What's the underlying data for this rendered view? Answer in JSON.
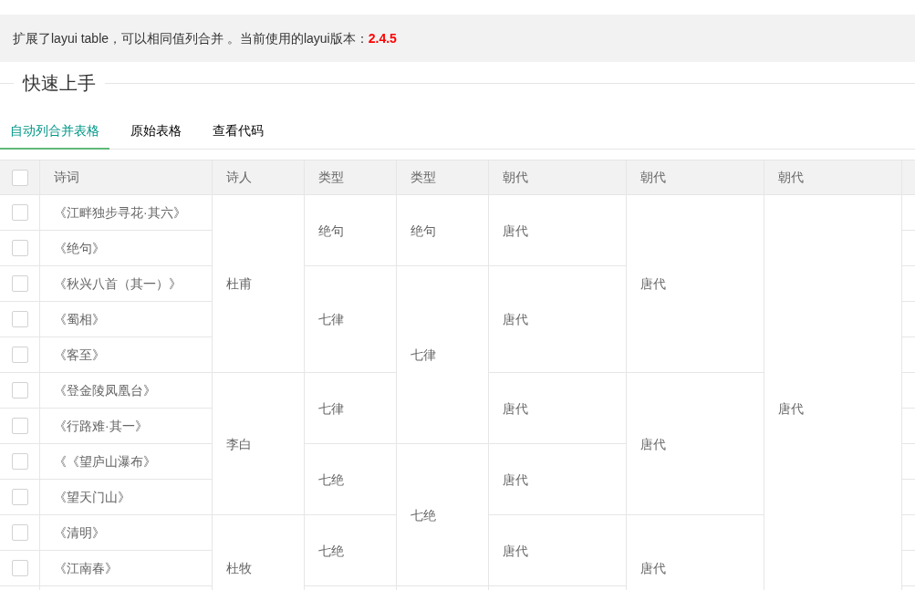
{
  "notice": {
    "text": "扩展了layui table，可以相同值列合并 。当前使用的layui版本：**2.4.5**"
  },
  "section": {
    "title": "快速上手"
  },
  "tabs": [
    {
      "label": "自动列合并表格",
      "selected": true
    },
    {
      "label": "原始表格",
      "selected": false
    },
    {
      "label": "查看代码",
      "selected": false
    }
  ],
  "table": {
    "header_checkbox": {
      "checked": false
    },
    "columns": [
      {
        "label": "诗词"
      },
      {
        "label": "诗人"
      },
      {
        "label": "类型"
      },
      {
        "label": "类型"
      },
      {
        "label": "朝代"
      },
      {
        "label": "朝代"
      },
      {
        "label": "朝代"
      }
    ],
    "rows": [
      {
        "selected": false,
        "cells": [
          {
            "text": "《江畔独步寻花·其六》"
          },
          {
            "text": "杜甫",
            "rowspan": 5
          },
          {
            "text": "绝句",
            "rowspan": 2
          },
          {
            "text": "绝句",
            "rowspan": 2
          },
          {
            "text": "唐代",
            "rowspan": 2
          },
          {
            "text": "唐代",
            "rowspan": 5
          },
          {
            "text": "唐代",
            "rowspan": 12
          }
        ]
      },
      {
        "selected": false,
        "cells": [
          {
            "text": "《绝句》"
          }
        ]
      },
      {
        "selected": false,
        "cells": [
          {
            "text": "《秋兴八首（其一）》"
          },
          {
            "text": "七律",
            "rowspan": 3
          },
          {
            "text": "七律",
            "rowspan": 5
          },
          {
            "text": "唐代",
            "rowspan": 3
          }
        ]
      },
      {
        "selected": false,
        "cells": [
          {
            "text": "《蜀相》"
          }
        ]
      },
      {
        "selected": false,
        "cells": [
          {
            "text": "《客至》"
          }
        ]
      },
      {
        "selected": false,
        "cells": [
          {
            "text": "《登金陵凤凰台》"
          },
          {
            "text": "李白",
            "rowspan": 4
          },
          {
            "text": "七律",
            "rowspan": 2
          },
          {
            "text": "唐代",
            "rowspan": 2
          },
          {
            "text": "唐代",
            "rowspan": 4
          }
        ]
      },
      {
        "selected": false,
        "cells": [
          {
            "text": "《行路难·其一》"
          }
        ]
      },
      {
        "selected": false,
        "cells": [
          {
            "text": "《《望庐山瀑布》"
          },
          {
            "text": "七绝",
            "rowspan": 2
          },
          {
            "text": "七绝",
            "rowspan": 4
          },
          {
            "text": "唐代",
            "rowspan": 2
          }
        ]
      },
      {
        "selected": false,
        "cells": [
          {
            "text": "《望天门山》"
          }
        ]
      },
      {
        "selected": false,
        "cells": [
          {
            "text": "《清明》"
          },
          {
            "text": "杜牧",
            "rowspan": 3
          },
          {
            "text": "七绝",
            "rowspan": 2
          },
          {
            "text": "唐代",
            "rowspan": 2
          },
          {
            "text": "唐代",
            "rowspan": 3
          }
        ]
      },
      {
        "selected": false,
        "cells": [
          {
            "text": "《江南春》"
          }
        ]
      }
    ]
  }
}
